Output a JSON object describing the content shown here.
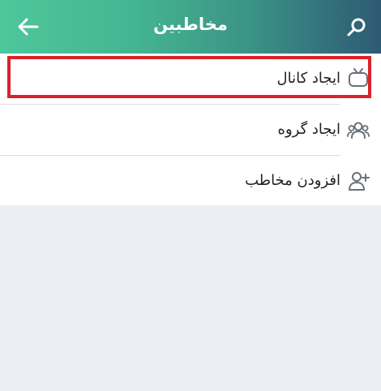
{
  "header": {
    "title": "مخاطبین",
    "back_icon": "arrow-left-icon",
    "search_icon": "search-icon",
    "gradient_colors": [
      "#4ec79c",
      "#2e5a74"
    ]
  },
  "menu": {
    "items": [
      {
        "label": "ایجاد کانال",
        "icon": "channel-tv-icon"
      },
      {
        "label": "ایجاد گروه",
        "icon": "group-icon"
      },
      {
        "label": "افزودن مخاطب",
        "icon": "add-contact-icon"
      }
    ]
  },
  "annotation": {
    "highlight_color": "#d8232a"
  }
}
